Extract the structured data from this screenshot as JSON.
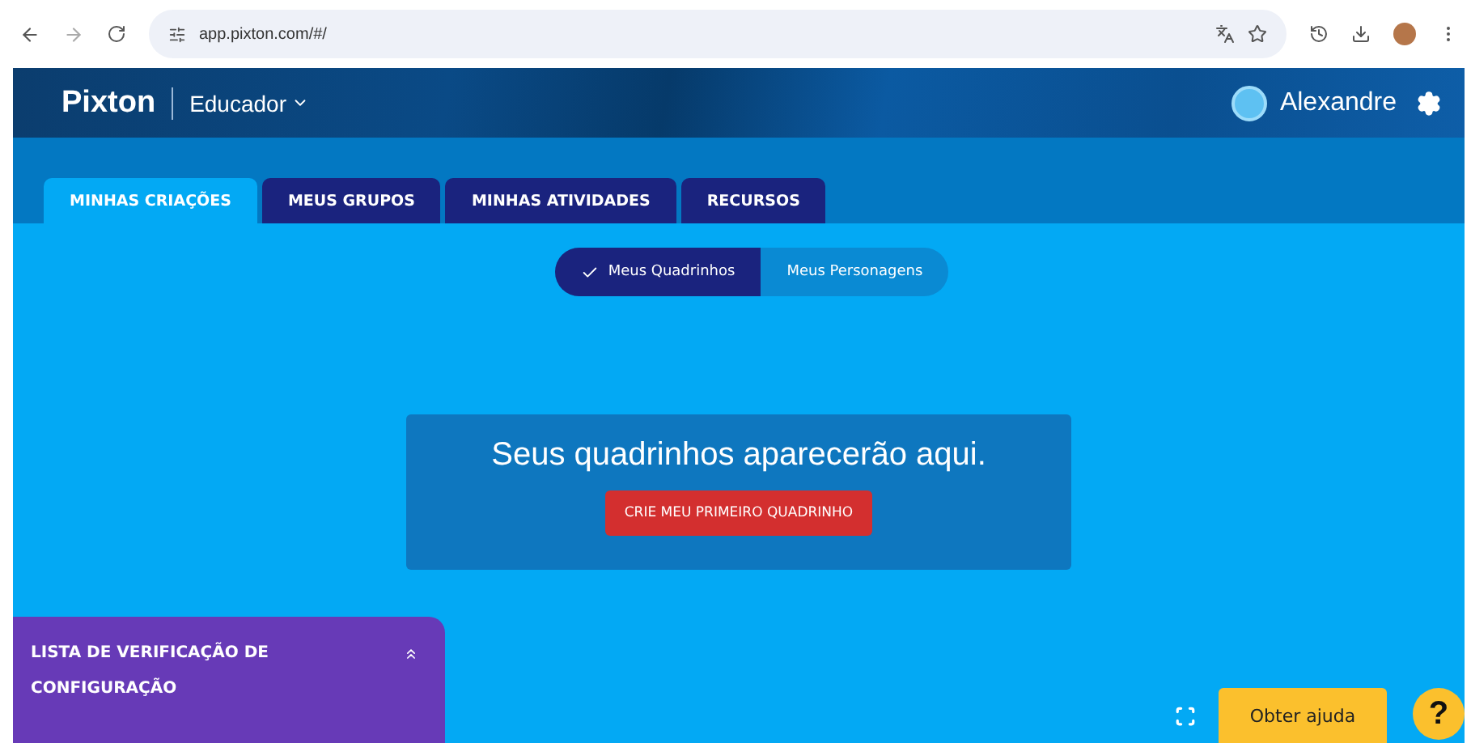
{
  "browser": {
    "url": "app.pixton.com/#/"
  },
  "header": {
    "logo": "Pixton",
    "role": "Educador",
    "user": "Alexandre"
  },
  "tabs": [
    {
      "label": "MINHAS CRIAÇÕES",
      "selected": true
    },
    {
      "label": "MEUS GRUPOS",
      "selected": false
    },
    {
      "label": "MINHAS ATIVIDADES",
      "selected": false
    },
    {
      "label": "RECURSOS",
      "selected": false
    }
  ],
  "view_toggle": [
    {
      "label": "Meus Quadrinhos",
      "selected": true
    },
    {
      "label": "Meus Personagens",
      "selected": false
    }
  ],
  "empty_state": {
    "message": "Seus quadrinhos aparecerão aqui.",
    "button": "CRIE MEU PRIMEIRO QUADRINHO"
  },
  "checklist": {
    "title": "LISTA DE VERIFICAÇÃO DE CONFIGURAÇÃO",
    "expanded": false
  },
  "help": {
    "label": "Obter ajuda",
    "icon": "?"
  }
}
